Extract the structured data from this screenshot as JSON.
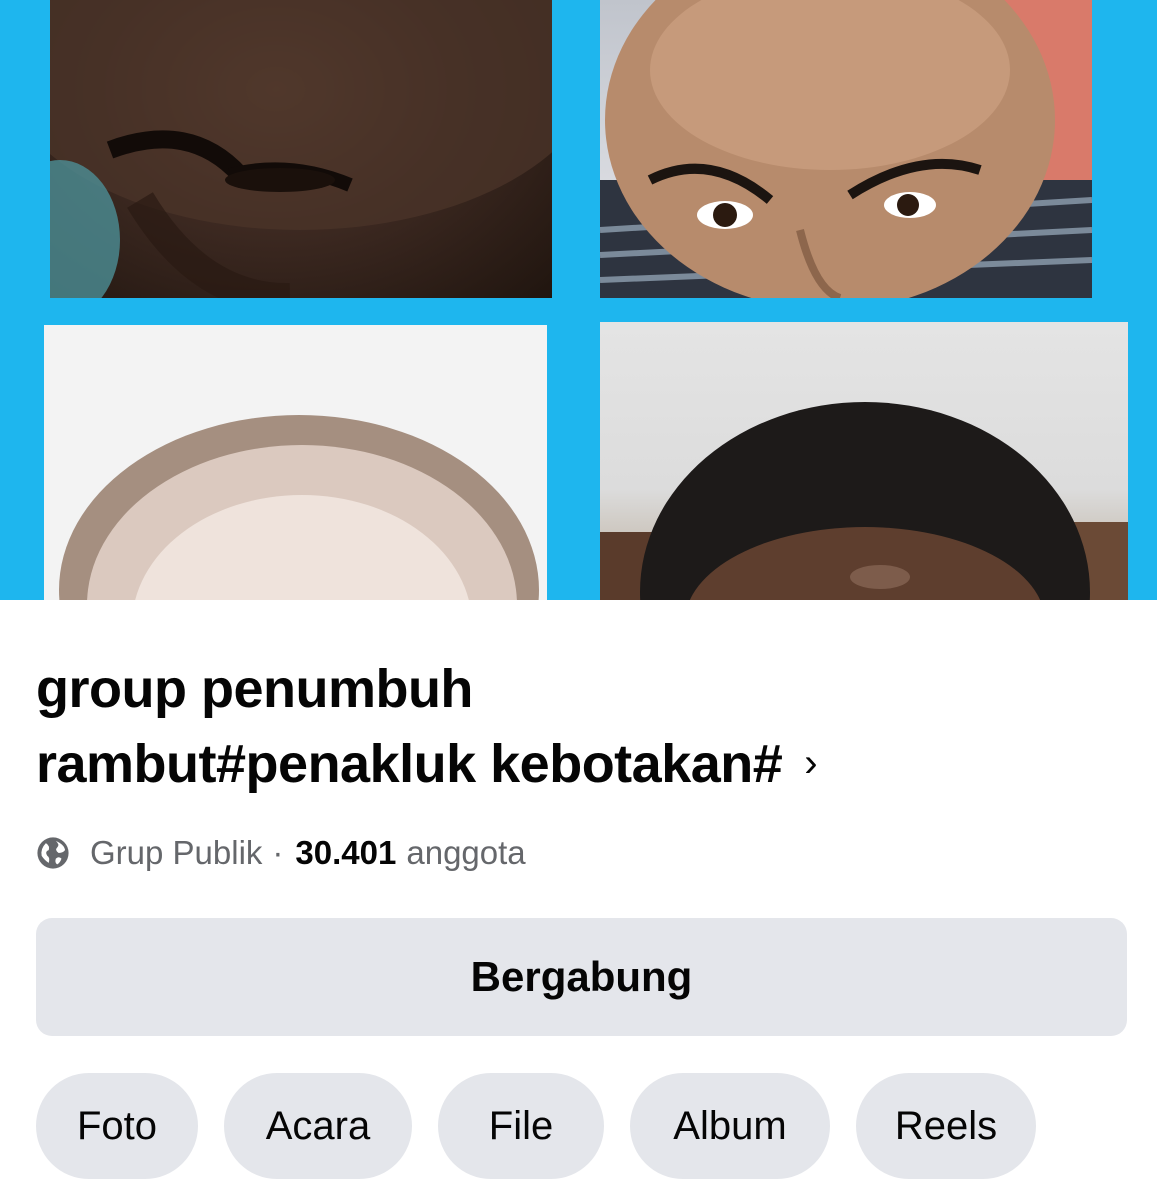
{
  "group": {
    "title_line1": "group penumbuh",
    "title_line2": "rambut#penakluk kebotakan#",
    "chevron": "›",
    "privacy": "Grup Publik",
    "separator": "·",
    "member_count": "30.401",
    "member_label": "anggota"
  },
  "actions": {
    "join_label": "Bergabung"
  },
  "tabs": [
    "Foto",
    "Acara",
    "File",
    "Album",
    "Reels"
  ],
  "icons": {
    "privacy": "globe-icon",
    "title_more": "chevron-right-icon"
  },
  "colors": {
    "cover_background": "#1eb6ee",
    "button_background": "#e4e6eb",
    "secondary_text": "#65676b"
  }
}
